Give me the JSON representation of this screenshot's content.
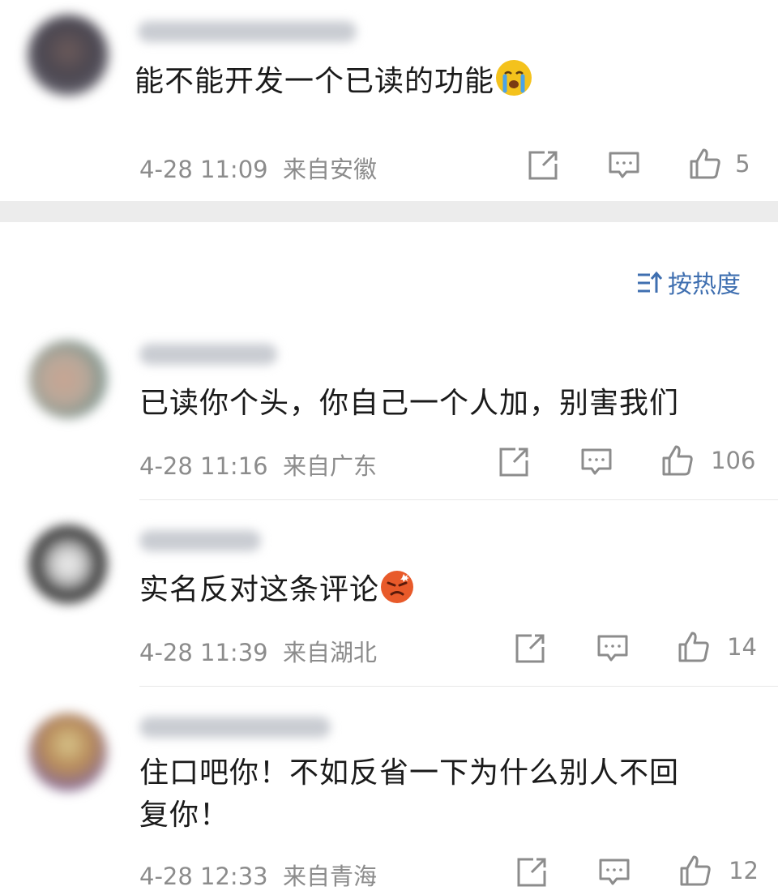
{
  "post": {
    "content": "能不能开发一个已读的功能",
    "emoji_icon": "crying-face-emoji",
    "time": "4-28 11:09",
    "location": "来自安徽",
    "like_count": "5"
  },
  "sort_label": "按热度",
  "comments": [
    {
      "content": "已读你个头，你自己一个人加，别害我们",
      "time": "4-28 11:16",
      "location": "来自广东",
      "like_count": "106"
    },
    {
      "content": "实名反对这条评论",
      "emoji_icon": "angry-face-emoji",
      "time": "4-28 11:39",
      "location": "来自湖北",
      "like_count": "14"
    },
    {
      "content_line1": "住口吧你！不如反省一下为什么别人不回",
      "content_line2": "复你！",
      "time": "4-28 12:33",
      "location": "来自青海",
      "like_count": "12"
    }
  ],
  "colors": {
    "accent": "#3f6fb0",
    "meta": "#8c8c8c",
    "separator": "#ececec"
  }
}
